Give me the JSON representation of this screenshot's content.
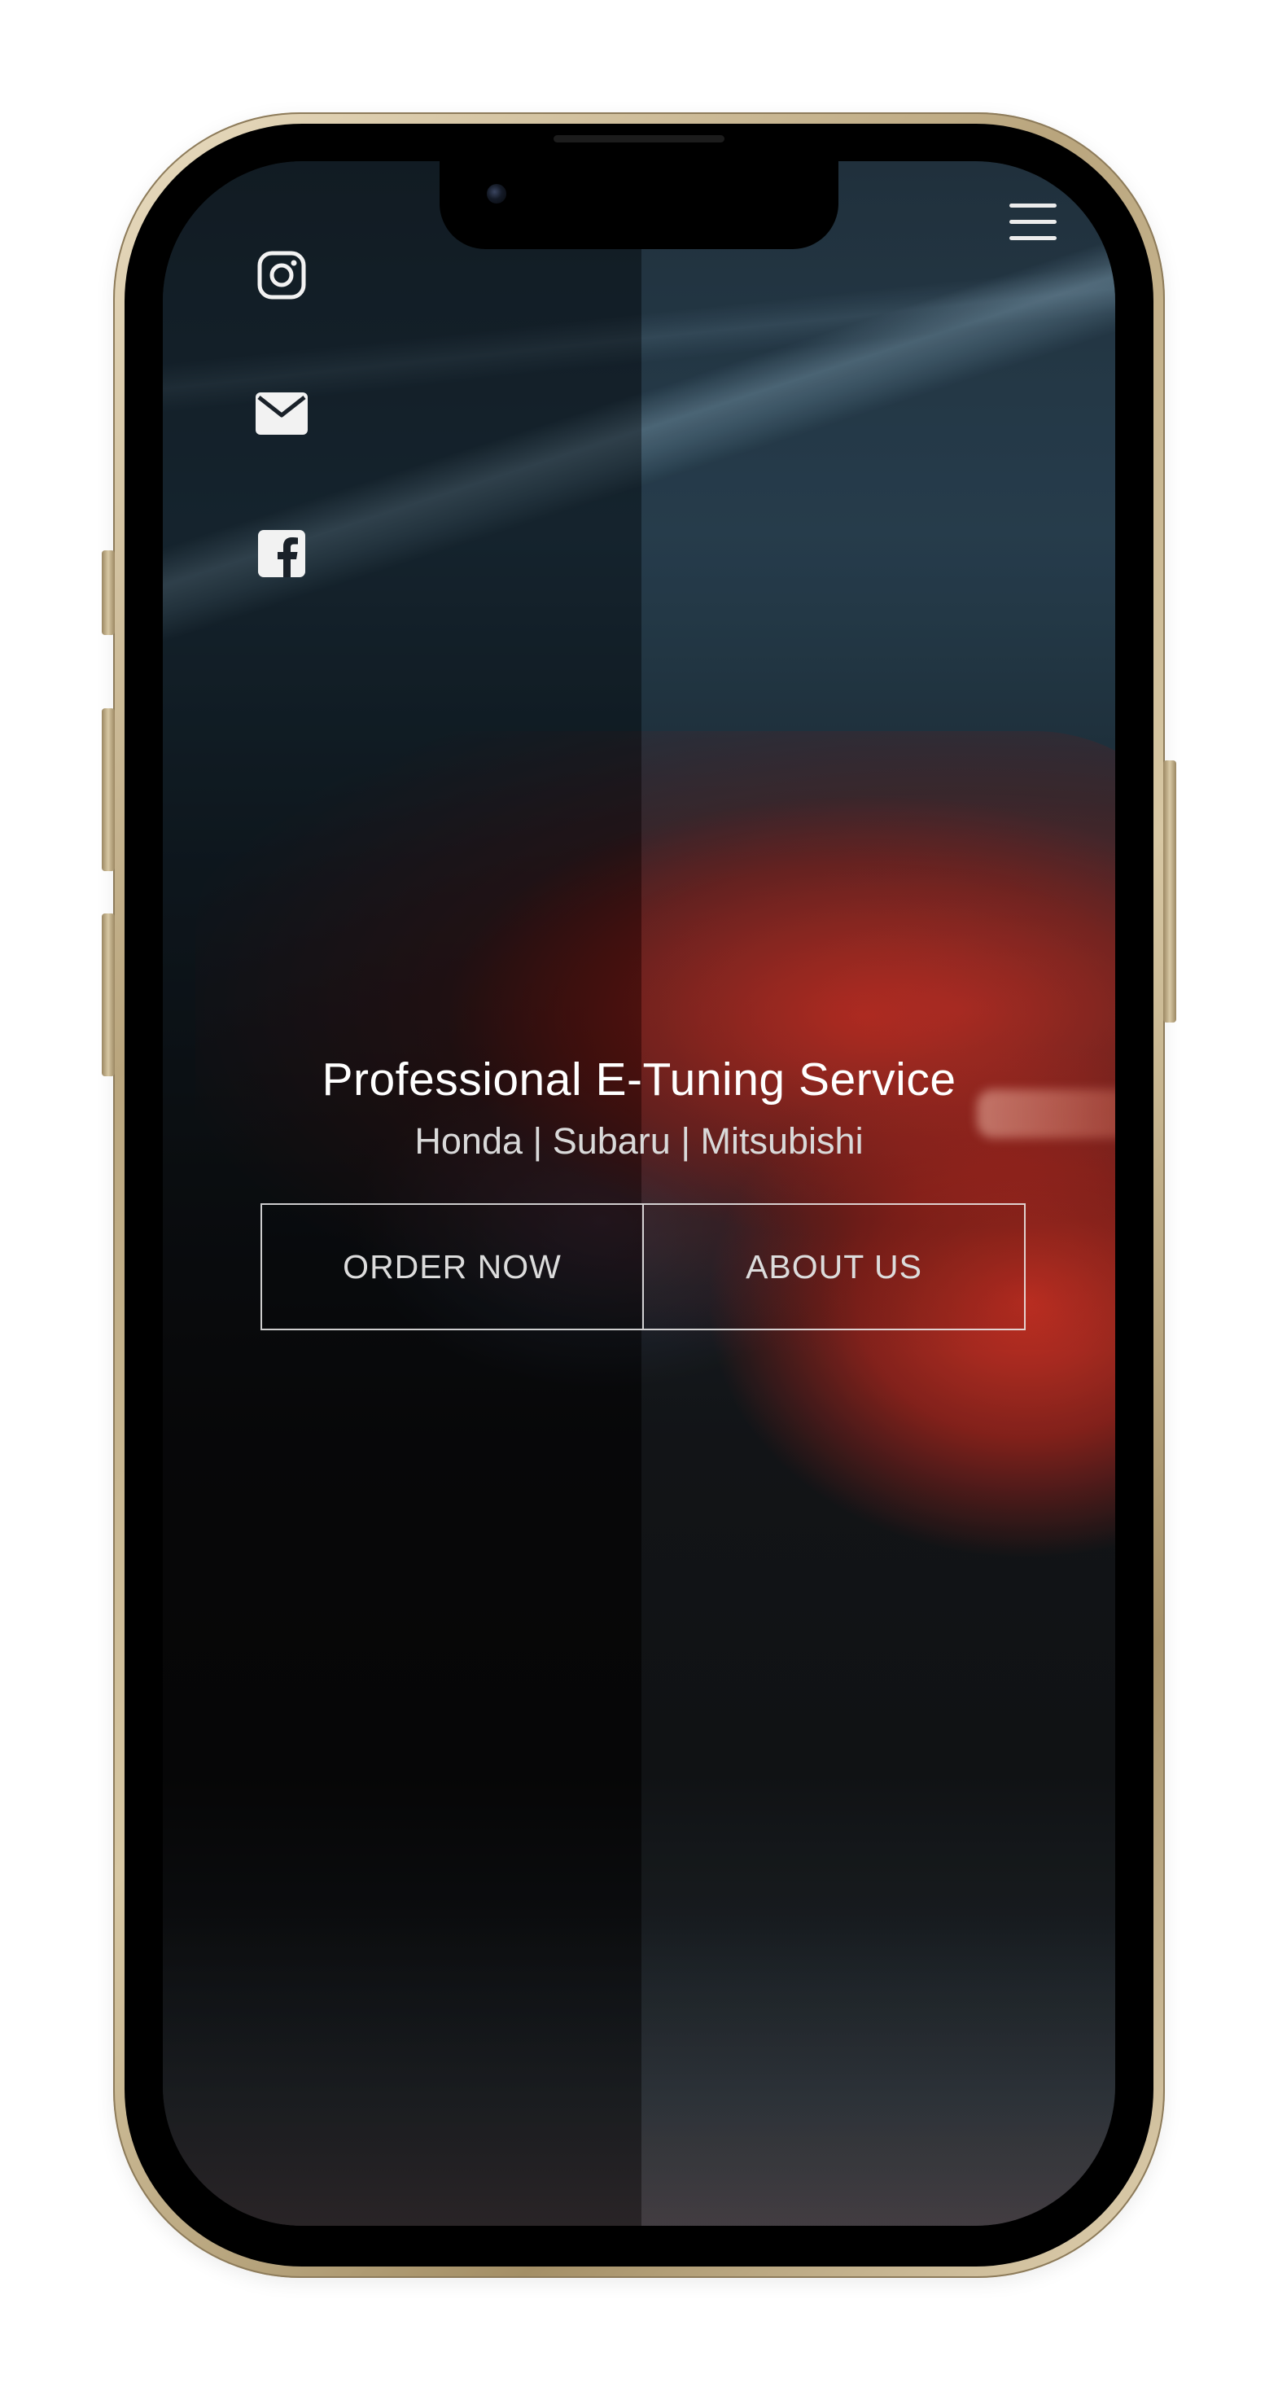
{
  "header": {
    "menu_icon": "hamburger-menu-icon"
  },
  "social": [
    {
      "name": "instagram",
      "icon": "instagram-icon"
    },
    {
      "name": "email",
      "icon": "mail-icon"
    },
    {
      "name": "facebook",
      "icon": "facebook-icon"
    }
  ],
  "hero": {
    "title": "Professional E-Tuning Service",
    "subtitle": "Honda | Subaru | Mitsubishi",
    "order_button": "ORDER NOW",
    "about_button": "ABOUT US"
  },
  "colors": {
    "device_frame": "#c9b48c",
    "text_primary": "#ffffff",
    "text_secondary": "#d9d9d9",
    "button_border": "#f0f0f0",
    "accent_red": "#c8281c"
  }
}
